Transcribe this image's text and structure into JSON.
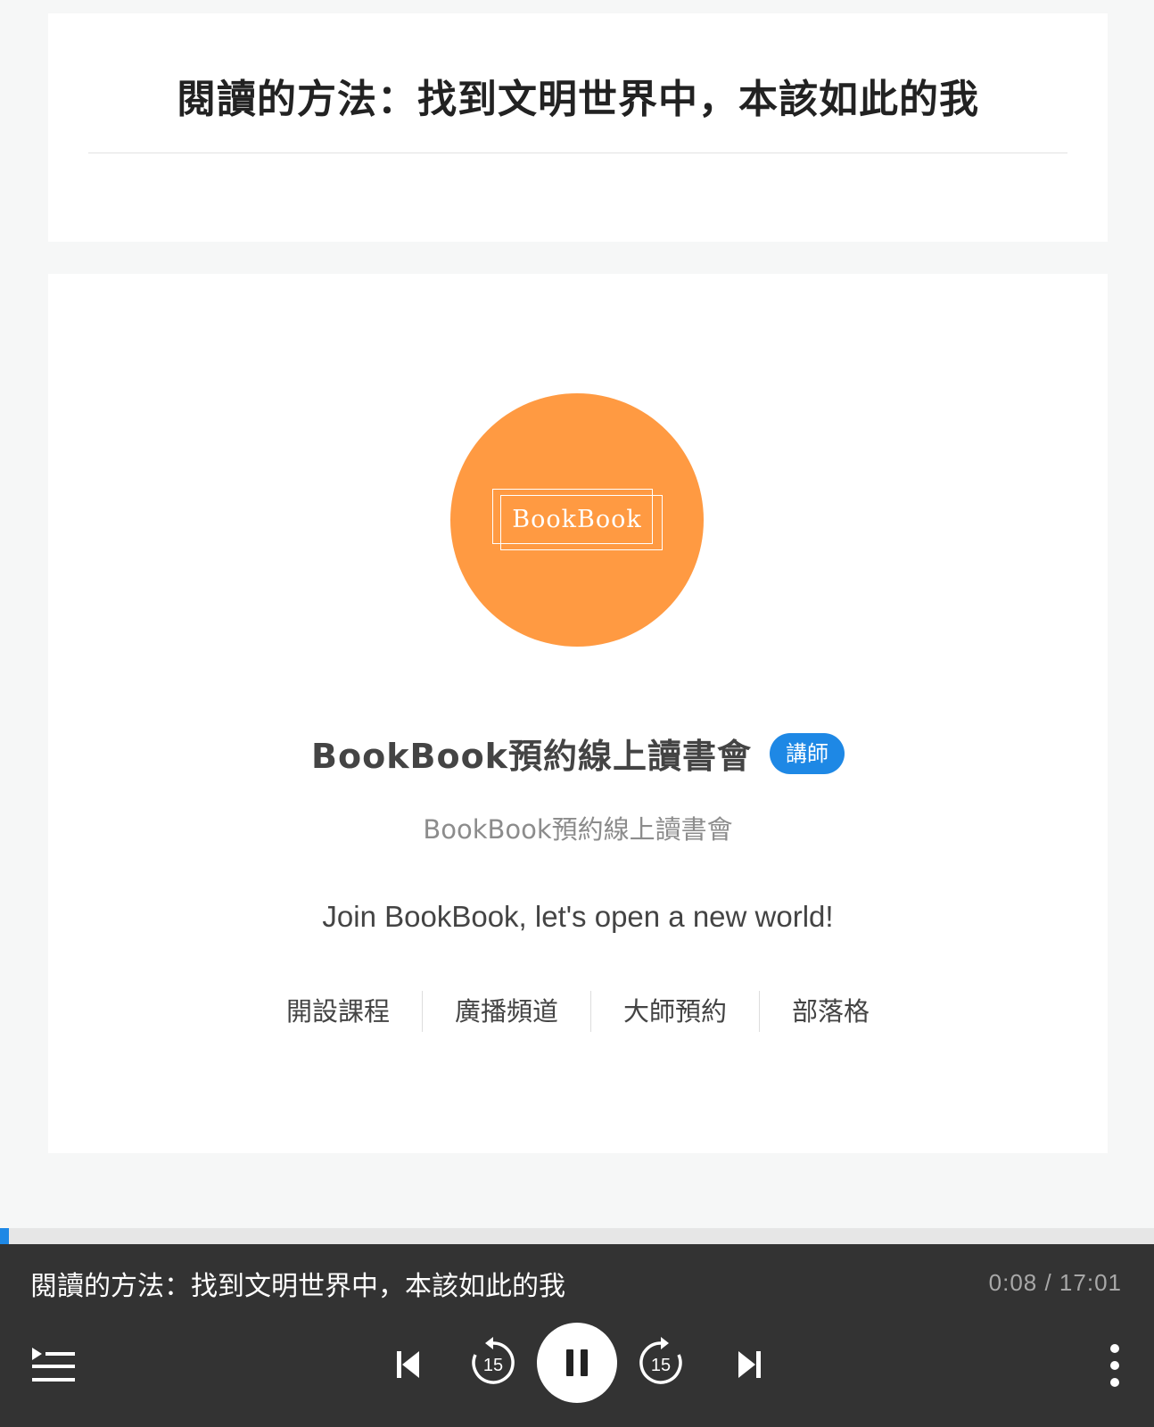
{
  "episode": {
    "title": "閱讀的方法：找到文明世界中，本該如此的我"
  },
  "channel": {
    "avatar_logo_text": "BookBook",
    "avatar_color": "#ff9a42",
    "name": "BookBook預約線上讀書會",
    "badge": "講師",
    "badge_color": "#1e88e5",
    "handle": "BookBook預約線上讀書會",
    "tagline": "Join BookBook, let's open a new world!",
    "links": [
      {
        "label": "開設課程"
      },
      {
        "label": "廣播頻道"
      },
      {
        "label": "大師預約"
      },
      {
        "label": "部落格"
      }
    ]
  },
  "player": {
    "now_playing": "閱讀的方法：找到文明世界中，本該如此的我",
    "time": "0:08 / 17:01",
    "progress_fraction": 0.0078,
    "skip_back_seconds": "15",
    "skip_forward_seconds": "15",
    "icons": {
      "playlist": "playlist-icon",
      "previous": "skip-previous-icon",
      "rewind": "rewind-15-icon",
      "pause": "pause-icon",
      "forward": "forward-15-icon",
      "next": "skip-next-icon",
      "more": "more-vertical-icon"
    }
  }
}
